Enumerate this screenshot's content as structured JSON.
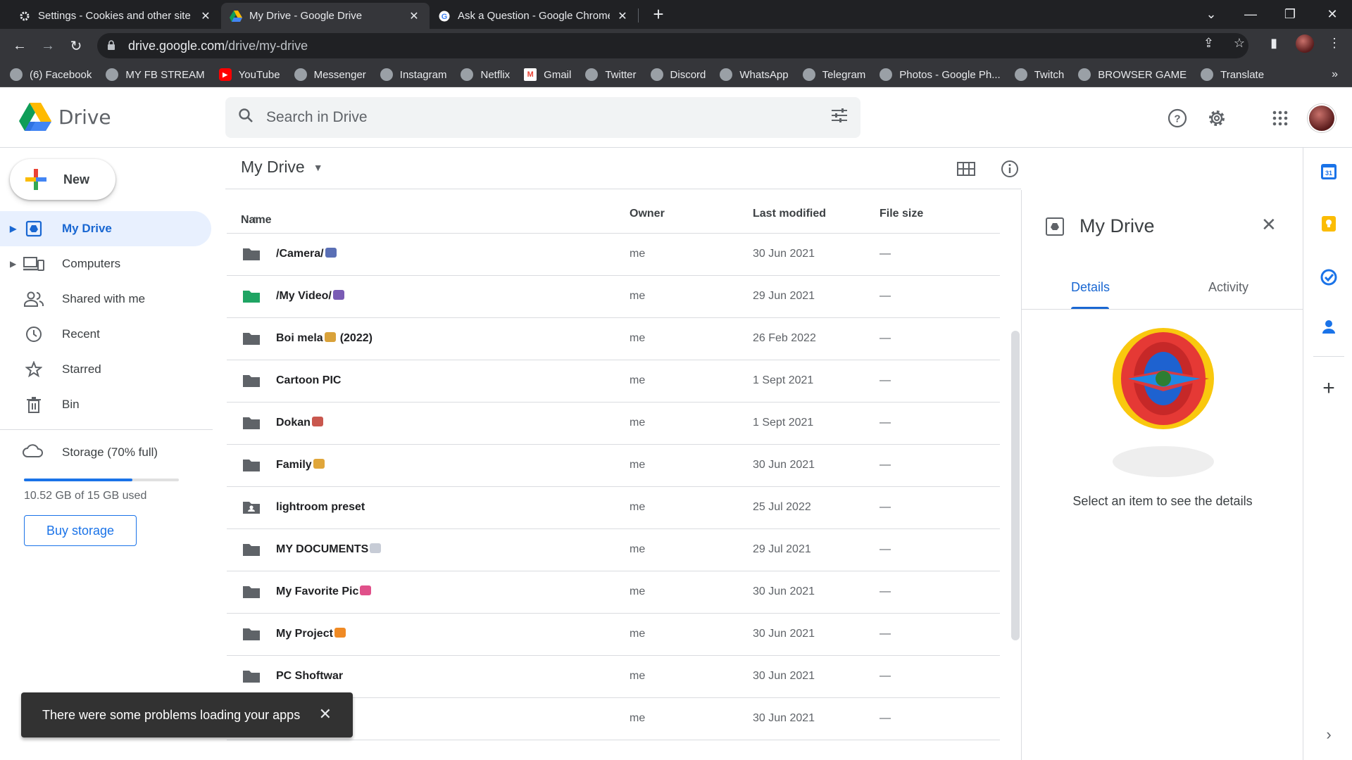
{
  "browser": {
    "tabs": [
      {
        "title": "Settings - Cookies and other site data",
        "icon": "gear-icon"
      },
      {
        "title": "My Drive - Google Drive",
        "icon": "drive-icon"
      },
      {
        "title": "Ask a Question - Google Chrome",
        "icon": "google-icon"
      }
    ],
    "url_domain": "drive.google.com",
    "url_path": "/drive/my-drive",
    "bookmarks": [
      "(6) Facebook",
      "MY FB STREAM",
      "YouTube",
      "Messenger",
      "Instagram",
      "Netflix",
      "Gmail",
      "Twitter",
      "Discord",
      "WhatsApp",
      "Telegram",
      "Photos - Google Ph...",
      "Twitch",
      "BROWSER GAME",
      "Translate"
    ],
    "bookmarks_more": "»"
  },
  "drive": {
    "logo_text": "Drive",
    "search_placeholder": "Search in Drive",
    "new_label": "New",
    "nav": [
      {
        "label": "My Drive",
        "icon": "my-drive-icon",
        "active": true
      },
      {
        "label": "Computers",
        "icon": "computers-icon"
      },
      {
        "label": "Shared with me",
        "icon": "shared-icon"
      },
      {
        "label": "Recent",
        "icon": "clock-icon"
      },
      {
        "label": "Starred",
        "icon": "star-icon"
      },
      {
        "label": "Bin",
        "icon": "bin-icon"
      }
    ],
    "storage": {
      "label": "Storage (70% full)",
      "used_fraction": 0.7,
      "text": "10.52 GB of 15 GB used",
      "buy_label": "Buy storage"
    },
    "main_title": "My Drive",
    "columns": {
      "name": "Name",
      "owner": "Owner",
      "modified": "Last modified",
      "size": "File size"
    },
    "files": [
      {
        "name": "/Camera/",
        "emoji_color": "#5a6fb5",
        "owner": "me",
        "modified": "30 Jun 2021",
        "size": "—",
        "folder": "plain"
      },
      {
        "name": "/My Video/",
        "emoji_color": "#7a5cb5",
        "owner": "me",
        "modified": "29 Jun 2021",
        "size": "—",
        "folder": "green"
      },
      {
        "name": "Boi mela",
        "suffix": "(2022)",
        "emoji_color": "#d9a23a",
        "owner": "me",
        "modified": "26 Feb 2022",
        "size": "—",
        "folder": "plain"
      },
      {
        "name": "Cartoon PIC",
        "owner": "me",
        "modified": "1 Sept 2021",
        "size": "—",
        "folder": "plain"
      },
      {
        "name": "Dokan",
        "emoji_color": "#c9574e",
        "owner": "me",
        "modified": "1 Sept 2021",
        "size": "—",
        "folder": "plain"
      },
      {
        "name": "Family",
        "emoji_color": "#e0a63a",
        "owner": "me",
        "modified": "30 Jun 2021",
        "size": "—",
        "folder": "plain"
      },
      {
        "name": "lightroom preset",
        "owner": "me",
        "modified": "25 Jul 2022",
        "size": "—",
        "folder": "shared"
      },
      {
        "name": "MY DOCUMENTS",
        "emoji_color": "#c7ccd6",
        "owner": "me",
        "modified": "29 Jul 2021",
        "size": "—",
        "folder": "plain"
      },
      {
        "name": "My Favorite Pic",
        "emoji_color": "#e0508a",
        "owner": "me",
        "modified": "30 Jun 2021",
        "size": "—",
        "folder": "plain"
      },
      {
        "name": "My Project",
        "emoji_color": "#f08a24",
        "owner": "me",
        "modified": "30 Jun 2021",
        "size": "—",
        "folder": "plain"
      },
      {
        "name": "PC Shoftwar",
        "owner": "me",
        "modified": "30 Jun 2021",
        "size": "—",
        "folder": "plain"
      },
      {
        "name": "",
        "owner": "me",
        "modified": "30 Jun 2021",
        "size": "—",
        "folder": "plain"
      }
    ],
    "details": {
      "title": "My Drive",
      "tab_details": "Details",
      "tab_activity": "Activity",
      "message": "Select an item to see the details"
    },
    "snackbar": "There were some problems loading your apps"
  },
  "colors": {
    "accent": "#1a73e8",
    "active_bg": "#e8f0fe",
    "chrome_dark": "#202124",
    "chrome_mid": "#35363a"
  }
}
